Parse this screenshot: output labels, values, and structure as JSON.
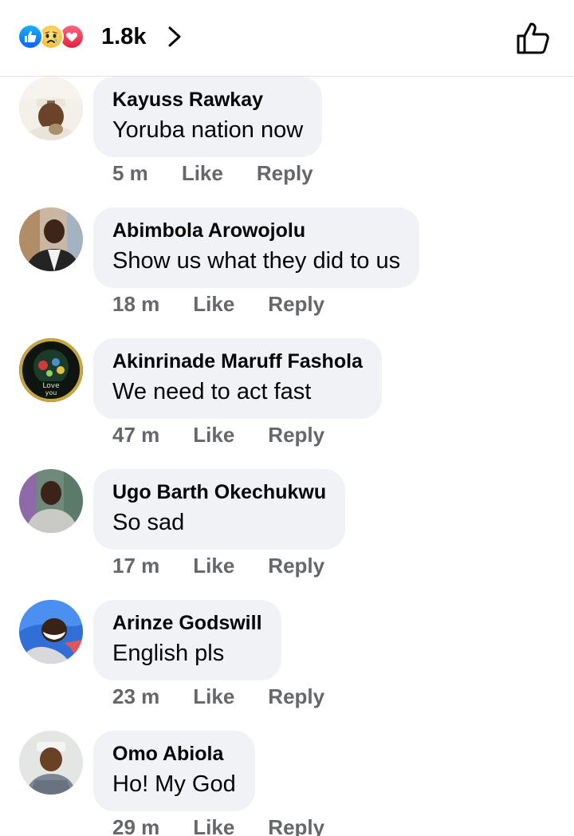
{
  "header": {
    "reaction_count": "1.8k",
    "reactions": [
      "like-reaction",
      "sad-reaction",
      "love-reaction"
    ],
    "colors": {
      "like": "#0866ff",
      "sad": "#f7b125",
      "love": "#e61e3b"
    }
  },
  "comments": [
    {
      "author": "Kayuss Rawkay",
      "text": "Yoruba nation now",
      "time": "5 m",
      "like": "Like",
      "reply": "Reply"
    },
    {
      "author": "Abimbola Arowojolu",
      "text": "Show us what they did to us",
      "time": "18 m",
      "like": "Like",
      "reply": "Reply"
    },
    {
      "author": "Akinrinade Maruff Fashola",
      "text": "We need to act fast",
      "time": "47 m",
      "like": "Like",
      "reply": "Reply",
      "avatar_text": "Love you"
    },
    {
      "author": "Ugo Barth Okechukwu",
      "text": "So sad",
      "time": "17 m",
      "like": "Like",
      "reply": "Reply"
    },
    {
      "author": "Arinze Godswill",
      "text": "English pls",
      "time": "23 m",
      "like": "Like",
      "reply": "Reply"
    },
    {
      "author": "Omo Abiola",
      "text": "Ho! My God",
      "time": "29 m",
      "like": "Like",
      "reply": "Reply"
    }
  ]
}
